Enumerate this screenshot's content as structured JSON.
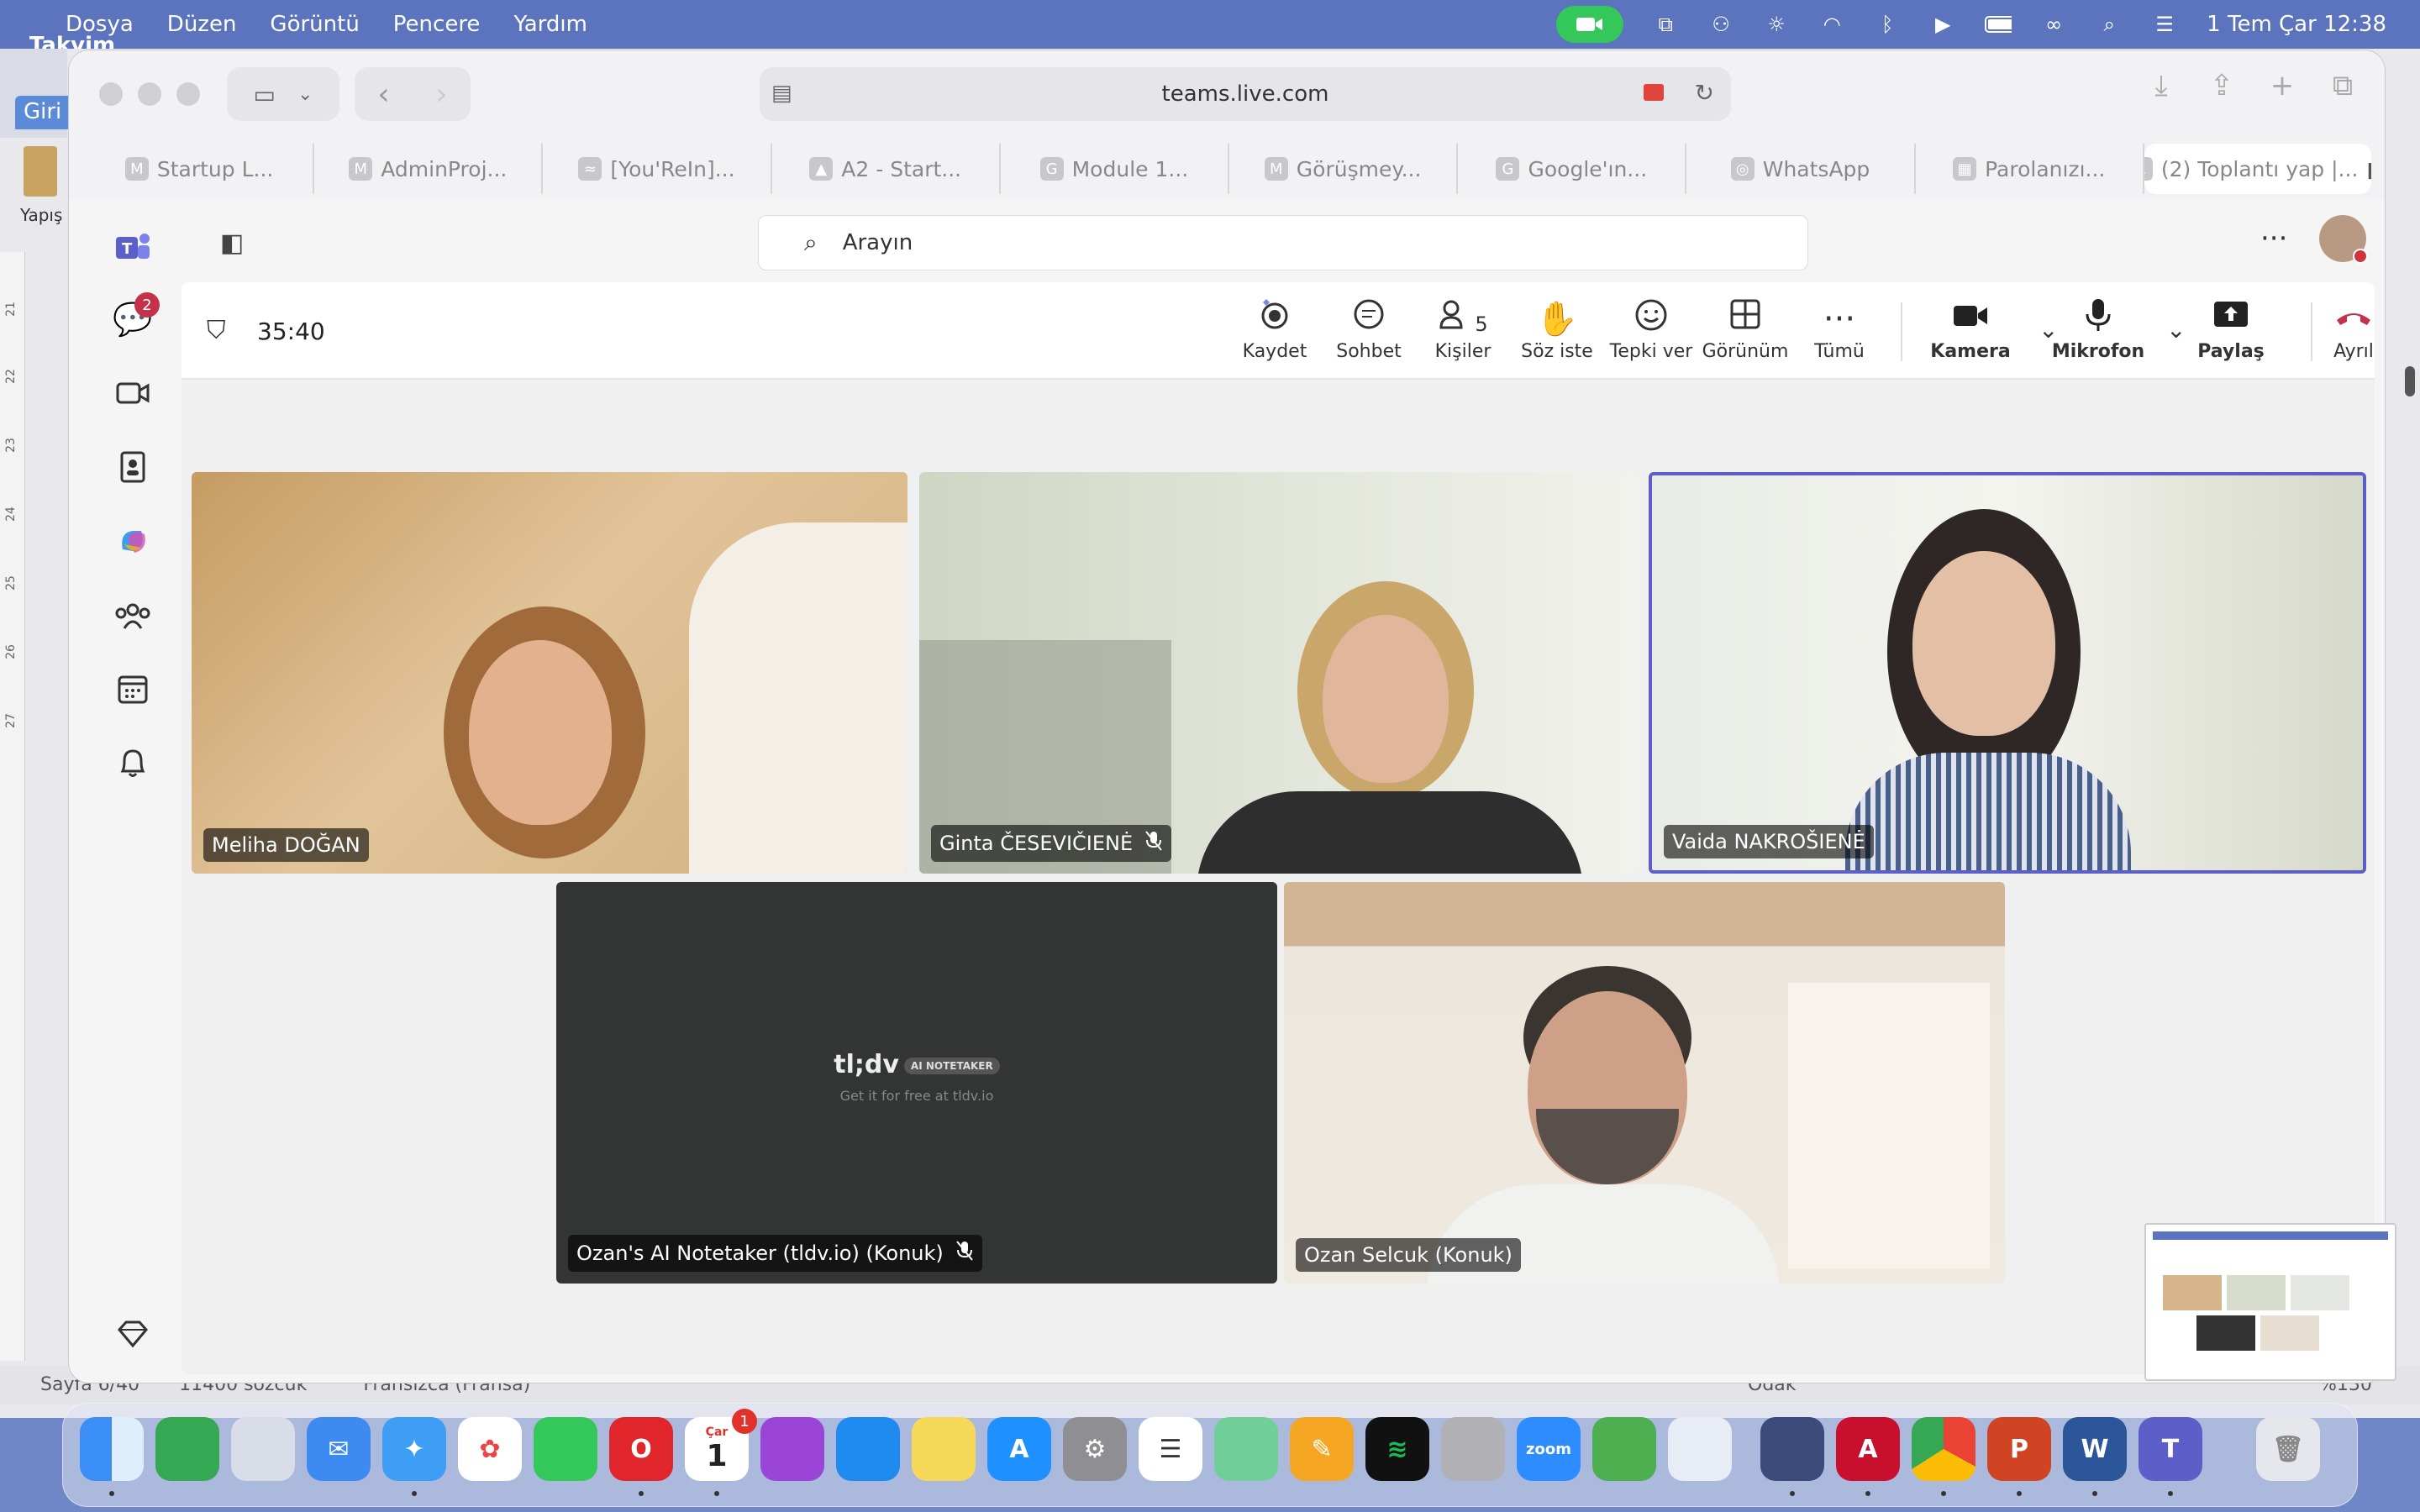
{
  "menubar": {
    "app": "Takvim",
    "items": [
      "Dosya",
      "Düzen",
      "Görüntü",
      "Pencere",
      "Yardım"
    ],
    "clock": "1 Tem Çar  12:38"
  },
  "background_app": {
    "tab_text": "Giri",
    "paste_label": "Yapış",
    "status_left": "Sayfa 6/40",
    "status_mid": "11400 sözcük",
    "status_lang": "Fransızca (Fransa)",
    "status_focus": "Odak",
    "status_zoom": "%130",
    "ruler_marks": [
      "21",
      "22",
      "23",
      "24",
      "25",
      "26",
      "27"
    ]
  },
  "browser": {
    "url": "teams.live.com",
    "tabs": [
      {
        "label": "Startup L...",
        "icon": "M"
      },
      {
        "label": "AdminProj...",
        "icon": "M"
      },
      {
        "label": "[You'ReIn]...",
        "icon": "≈"
      },
      {
        "label": "A2 - Start...",
        "icon": "▲"
      },
      {
        "label": "Module 1...",
        "icon": "G"
      },
      {
        "label": "Görüşmey...",
        "icon": "M"
      },
      {
        "label": "Google'ın...",
        "icon": "G"
      },
      {
        "label": "WhatsApp",
        "icon": "◎"
      },
      {
        "label": "Parolanızı...",
        "icon": "▦"
      },
      {
        "label": "(2) Toplantı yap |...",
        "icon": "L"
      }
    ]
  },
  "teams": {
    "search_placeholder": "Arayın",
    "chat_badge": "2",
    "meeting": {
      "timer": "35:40",
      "controls": {
        "record": "Kaydet",
        "chat": "Sohbet",
        "people": "Kişiler",
        "people_count": "5",
        "raise_hand": "Söz iste",
        "react": "Tepki ver",
        "view": "Görünüm",
        "more": "Tümü",
        "camera": "Kamera",
        "mic": "Mikrofon",
        "share": "Paylaş",
        "leave": "Ayrıl"
      },
      "participants": [
        {
          "name": "Meliha DOĞAN",
          "muted": false
        },
        {
          "name": "Ginta ČESEVIČIENĖ",
          "muted": true
        },
        {
          "name": "Vaida NAKROŠIENĖ",
          "muted": false,
          "active_speaker": true
        },
        {
          "name": "Ozan's AI Notetaker (tldv.io) (Konuk)",
          "muted": true
        },
        {
          "name": "Ozan Selcuk (Konuk)",
          "muted": false
        }
      ],
      "notetaker_logo": "tl;dv",
      "notetaker_tag": "AI NOTETAKER",
      "notetaker_sub": "Get it for free at tldv.io"
    }
  },
  "dock": {
    "calendar_day": "1",
    "calendar_month": "Çar",
    "calendar_badge": "1",
    "zoom_label": "zoom"
  },
  "colors": {
    "menubar": "#5b74bd",
    "teams_accent": "#5b5fc7",
    "leave_red": "#c4314b",
    "active_speaker_border": "#5b5fc7"
  }
}
